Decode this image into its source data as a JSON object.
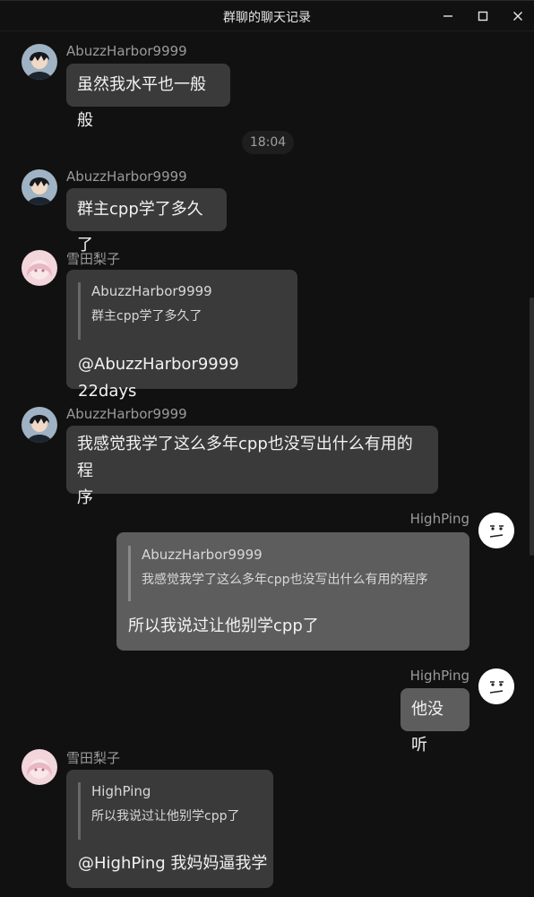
{
  "window": {
    "title": "群聊的聊天记录"
  },
  "messages": [
    {
      "sender": "AbuzzHarbor9999",
      "text": "虽然我水平也一般般"
    },
    {
      "time": "18:04"
    },
    {
      "sender": "AbuzzHarbor9999",
      "text": "群主cpp学了多久了"
    },
    {
      "sender": "雪田梨子",
      "quote_name": "AbuzzHarbor9999",
      "quote_text": "群主cpp学了多久了",
      "text": "@AbuzzHarbor9999 22days"
    },
    {
      "sender": "AbuzzHarbor9999",
      "text_line1": "我感觉我学了这么多年cpp也没写出什么有用的程",
      "text_line2": "序"
    },
    {
      "sender": "HighPing",
      "quote_name": "AbuzzHarbor9999",
      "quote_text": "我感觉我学了这么多年cpp也没写出什么有用的程序",
      "text": "所以我说过让他别学cpp了"
    },
    {
      "sender": "HighPing",
      "text": "他没听"
    },
    {
      "sender": "雪田梨子",
      "quote_name": "HighPing",
      "quote_text": "所以我说过让他别学cpp了",
      "text": "@HighPing 我妈妈逼我学"
    }
  ],
  "icons": {
    "minimize": "minimize-icon",
    "maximize": "maximize-icon",
    "close": "close-icon"
  },
  "colors": {
    "background": "#111111",
    "bubble_other": "#3a3a3a",
    "bubble_self": "#5d5d5d",
    "sender_name": "#9a9a9a"
  }
}
